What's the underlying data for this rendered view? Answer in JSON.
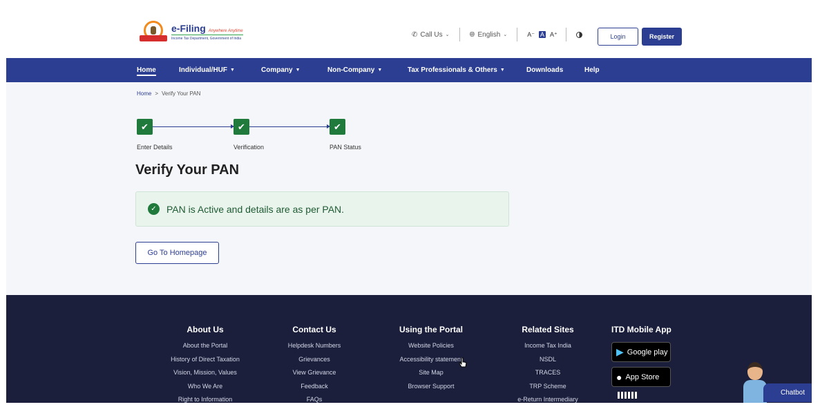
{
  "header": {
    "logo_title": "e-Filing",
    "logo_tagline": "Anywhere Anytime",
    "logo_subtitle": "Income Tax Department, Government of India",
    "call_us": "Call Us",
    "language": "English",
    "font_small": "A⁻",
    "font_normal": "A",
    "font_large": "A⁺",
    "login": "Login",
    "register": "Register"
  },
  "nav": {
    "items": [
      {
        "label": "Home",
        "active": true
      },
      {
        "label": "Individual/HUF",
        "dropdown": true
      },
      {
        "label": "Company",
        "dropdown": true
      },
      {
        "label": "Non-Company",
        "dropdown": true
      },
      {
        "label": "Tax Professionals & Others",
        "dropdown": true
      },
      {
        "label": "Downloads"
      },
      {
        "label": "Help"
      }
    ]
  },
  "breadcrumb": {
    "home": "Home",
    "separator": ">",
    "current": "Verify Your PAN"
  },
  "stepper": {
    "steps": [
      {
        "label": "Enter Details",
        "status": "done"
      },
      {
        "label": "Verification",
        "status": "done"
      },
      {
        "label": "PAN Status",
        "status": "done"
      }
    ]
  },
  "main": {
    "title": "Verify Your PAN",
    "alert_text": "PAN is Active and details are as per PAN.",
    "go_home": "Go To Homepage"
  },
  "footer": {
    "columns": [
      {
        "heading": "About Us",
        "links": [
          "About the Portal",
          "History of Direct Taxation",
          "Vision, Mission, Values",
          "Who We Are",
          "Right to Information"
        ]
      },
      {
        "heading": "Contact Us",
        "links": [
          "Helpdesk Numbers",
          "Grievances",
          "View Grievance",
          "Feedback",
          "FAQs"
        ]
      },
      {
        "heading": "Using the Portal",
        "links": [
          "Website Policies",
          "Accessibility statement",
          "Site Map",
          "Browser Support"
        ]
      },
      {
        "heading": "Related Sites",
        "links": [
          "Income Tax India",
          "NSDL",
          "TRACES",
          "TRP Scheme",
          "e-Return Intermediary"
        ]
      }
    ],
    "mobile_app": {
      "heading": "ITD Mobile App",
      "google_play": "Google play",
      "app_store": "App Store"
    }
  },
  "chatbot": {
    "label": "Chatbot"
  },
  "colors": {
    "brand": "#2c3e91",
    "success": "#1f7a3b",
    "footer_bg": "#1b1f3b"
  }
}
